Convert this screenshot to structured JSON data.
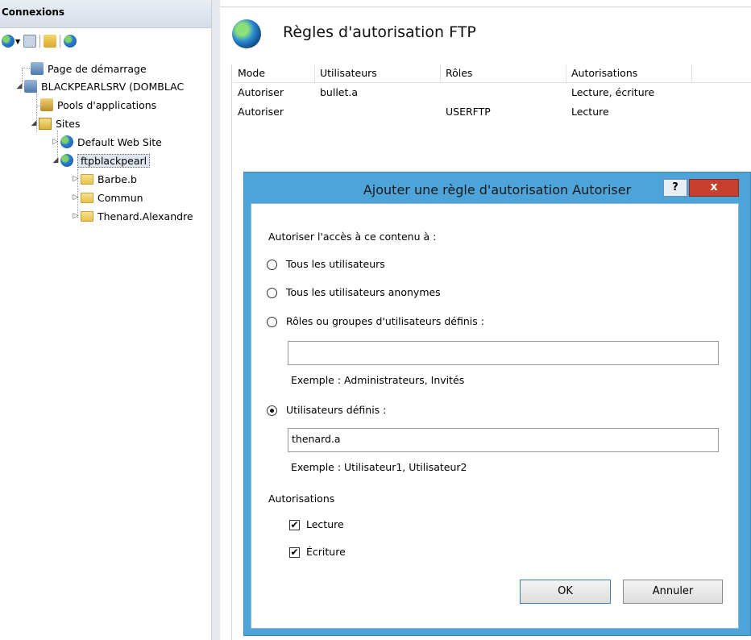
{
  "connections": {
    "header": "Connexions",
    "tree": [
      {
        "label": "Page de démarrage"
      },
      {
        "label": "BLACKPEARLSRV (DOMBLAC"
      },
      {
        "label": "Pools d'applications"
      },
      {
        "label": "Sites"
      },
      {
        "label": "Default Web Site"
      },
      {
        "label": "ftpblackpearl"
      },
      {
        "label": "Barbe.b"
      },
      {
        "label": "Commun"
      },
      {
        "label": "Thenard.Alexandre"
      }
    ]
  },
  "feature": {
    "title": "Règles d'autorisation FTP",
    "columns": [
      "Mode",
      "Utilisateurs",
      "Rôles",
      "Autorisations"
    ],
    "rows": [
      [
        "Autoriser",
        "bullet.a",
        "",
        "Lecture, écriture"
      ],
      [
        "Autoriser",
        "",
        "USERFTP",
        "Lecture"
      ]
    ]
  },
  "dialog": {
    "title": "Ajouter une règle d'autorisation Autoriser",
    "help_label": "?",
    "close_label": "x",
    "access_label": "Autoriser l'accès à ce contenu à :",
    "options": {
      "all_users": "Tous les utilisateurs",
      "anon_users": "Tous les utilisateurs anonymes",
      "roles": "Rôles ou groupes d'utilisateurs définis :",
      "users": "Utilisateurs définis :"
    },
    "selected_option": "users",
    "roles_value": "",
    "roles_example": "Exemple : Administrateurs, Invités",
    "users_value": "thenard.a",
    "users_example": "Exemple : Utilisateur1, Utilisateur2",
    "permissions_label": "Autorisations",
    "permissions": {
      "read": {
        "label": "Lecture",
        "checked": true
      },
      "write": {
        "label": "Écriture",
        "checked": true
      }
    },
    "ok_label": "OK",
    "cancel_label": "Annuler"
  },
  "colors": {
    "dialog_frame": "#4ea3d9",
    "close_button": "#c7402f"
  }
}
